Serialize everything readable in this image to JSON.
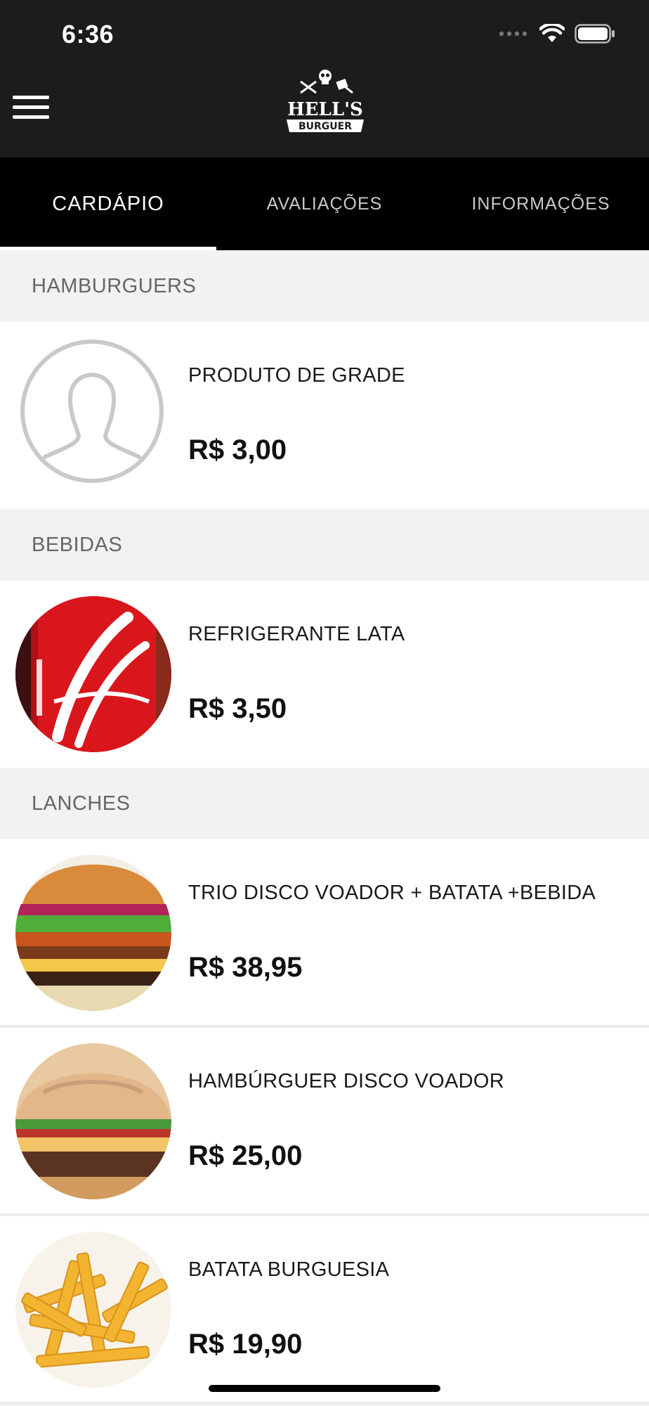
{
  "status_bar": {
    "time": "6:36"
  },
  "header": {
    "menu_icon": "hamburger-menu-icon",
    "logo_line1": "HELL'S",
    "logo_line2": "BURGUER"
  },
  "tabs": [
    {
      "label": "CARDÁPIO",
      "active": true
    },
    {
      "label": "AVALIAÇÕES",
      "active": false
    },
    {
      "label": "INFORMAÇÕES",
      "active": false
    }
  ],
  "sections": [
    {
      "title": "HAMBURGUERS",
      "items": [
        {
          "name": "PRODUTO DE GRADE",
          "price": "R$ 3,00",
          "image": "placeholder-person"
        }
      ]
    },
    {
      "title": "BEBIDAS",
      "items": [
        {
          "name": "REFRIGERANTE LATA",
          "price": "R$ 3,50",
          "image": "coca-cola-can"
        }
      ]
    },
    {
      "title": "LANCHES",
      "items": [
        {
          "name": "TRIO DISCO VOADOR + BATATA +BEBIDA",
          "price": "R$ 38,95",
          "image": "burger-stack"
        },
        {
          "name": "HAMBÚRGUER DISCO VOADOR",
          "price": "R$ 25,00",
          "image": "burger"
        },
        {
          "name": "BATATA BURGUESIA",
          "price": "R$ 19,90",
          "image": "fries"
        }
      ]
    }
  ],
  "colors": {
    "header_bg": "#1d1b1c",
    "tabs_bg": "#000000",
    "section_bg": "#f2f2f2",
    "coke_red": "#d9161c"
  }
}
